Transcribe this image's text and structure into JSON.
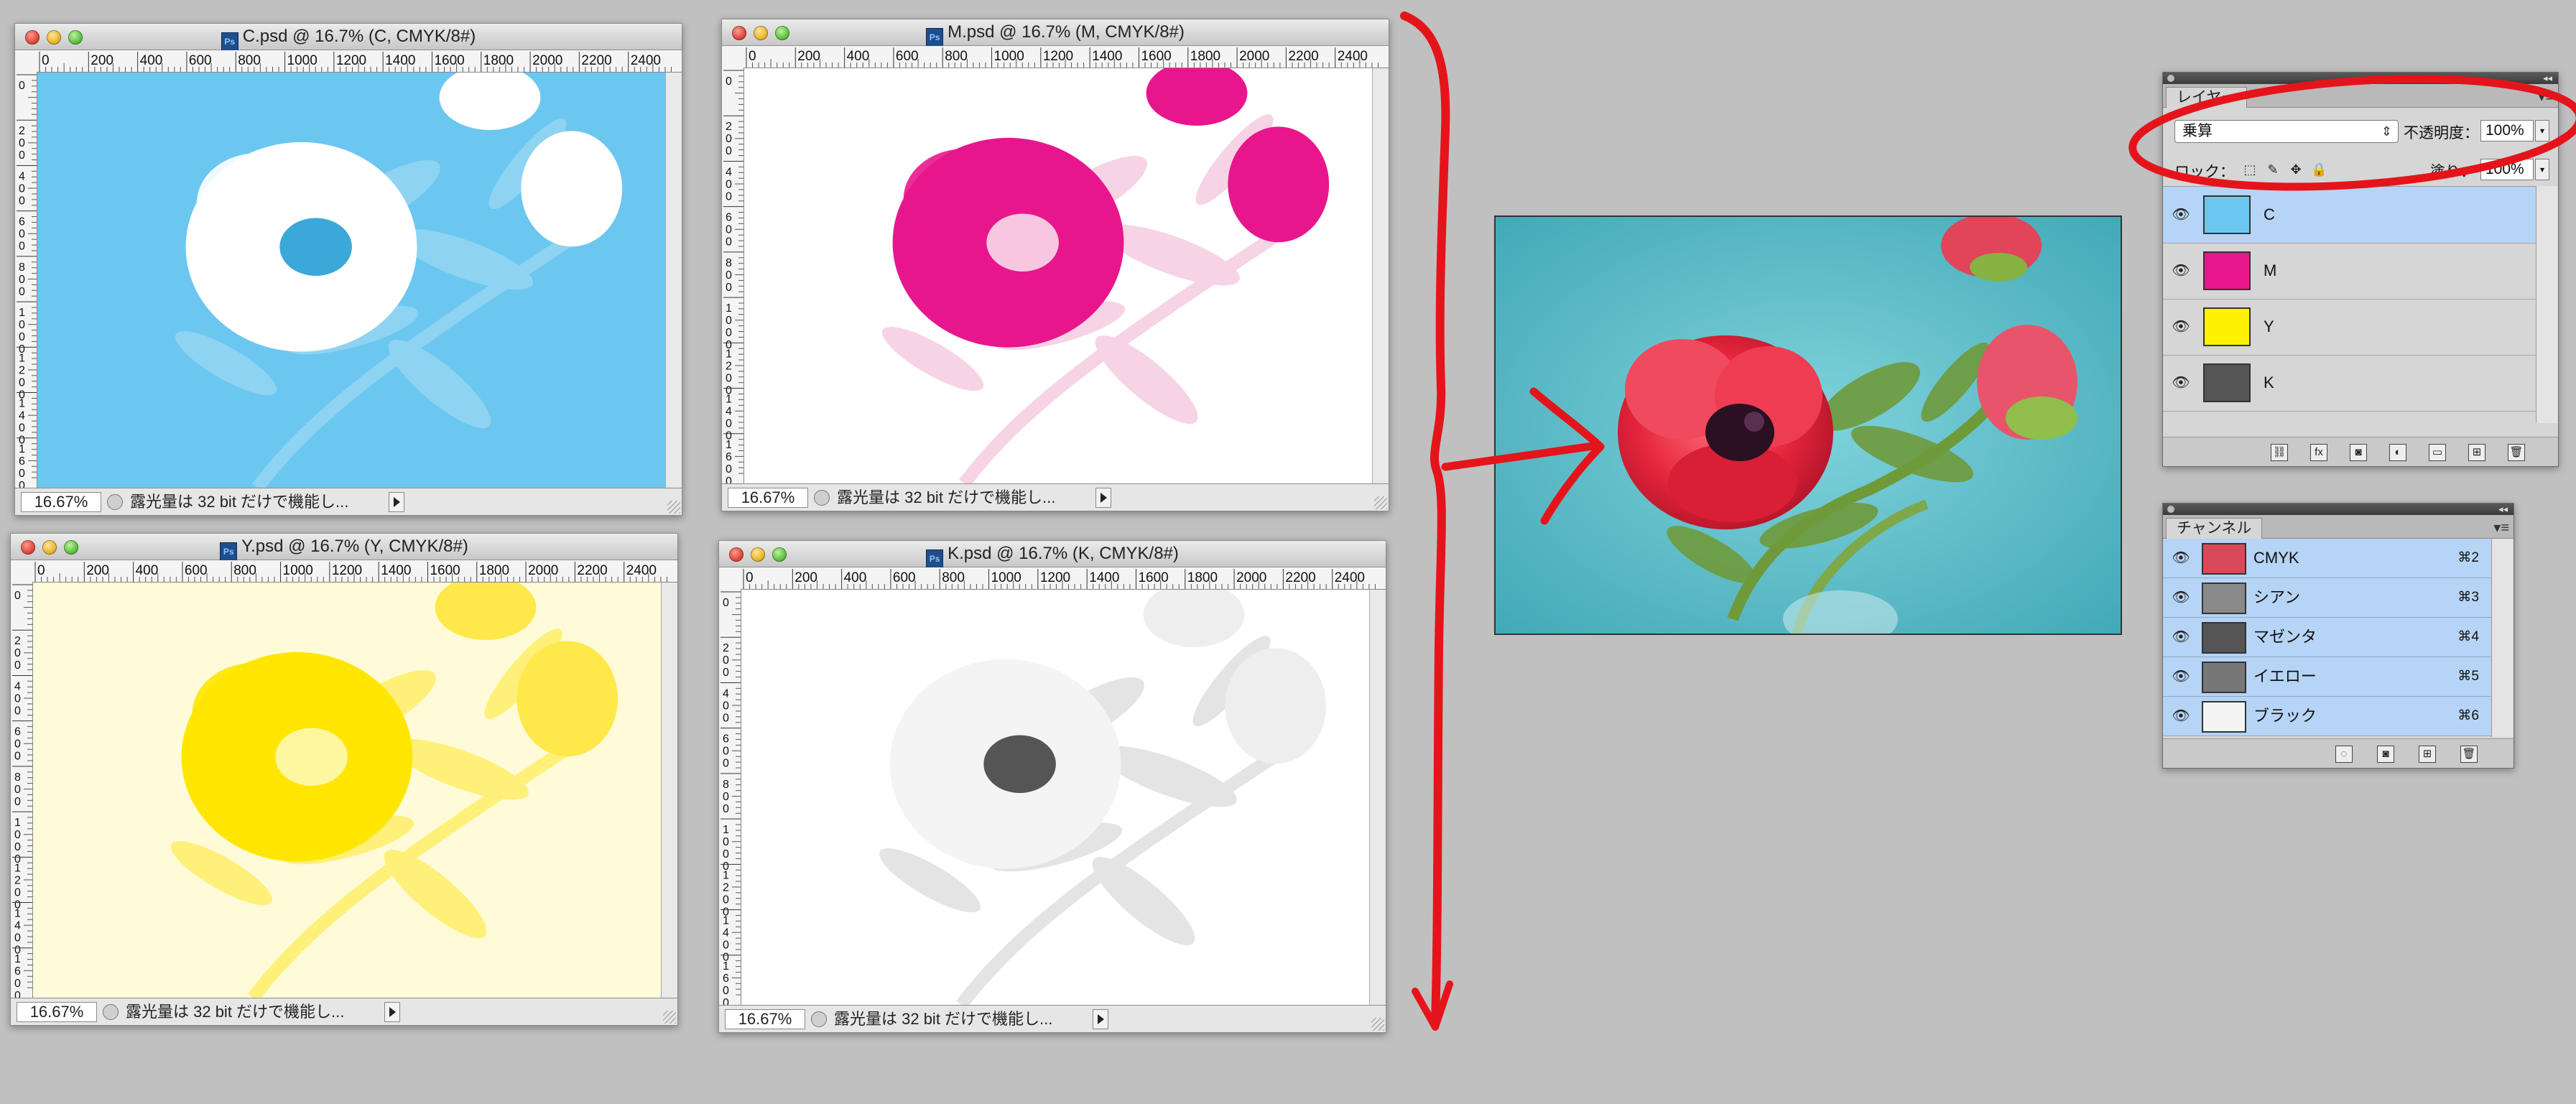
{
  "documents": [
    {
      "title": "C.psd @ 16.7% (C, CMYK/8#)",
      "zoom": "16.67%",
      "status": "露光量は 32 bit だけで機能し...",
      "tint": "#6cc7f0",
      "inkmode": "cyan"
    },
    {
      "title": "M.psd @ 16.7% (M, CMYK/8#)",
      "zoom": "16.67%",
      "status": "露光量は 32 bit だけで機能し...",
      "tint": "#e8168c",
      "inkmode": "magenta"
    },
    {
      "title": "Y.psd @ 16.7% (Y, CMYK/8#)",
      "zoom": "16.67%",
      "status": "露光量は 32 bit だけで機能し...",
      "tint": "#fff200",
      "inkmode": "yellow"
    },
    {
      "title": "K.psd @ 16.7% (K, CMYK/8#)",
      "zoom": "16.67%",
      "status": "露光量は 32 bit だけで機能し...",
      "tint": "#333333",
      "inkmode": "black"
    }
  ],
  "ruler": {
    "top_ticks": [
      "0",
      "200",
      "400",
      "600",
      "800",
      "1000",
      "1200",
      "1400",
      "1600",
      "1800",
      "2000",
      "2200",
      "2400"
    ],
    "left_ticks": [
      "0",
      "200",
      "400",
      "600",
      "800",
      "1000",
      "1200",
      "1400",
      "1600"
    ]
  },
  "layers_panel": {
    "tab": "レイヤー",
    "blend_mode": "乗算",
    "opacity_label": "不透明度：",
    "opacity": "100%",
    "lock_label": "ロック：",
    "fill_label": "塗り：",
    "fill": "100%",
    "layers": [
      {
        "name": "C",
        "selected": true,
        "thumb": "#6cc7f0"
      },
      {
        "name": "M",
        "selected": false,
        "thumb": "#e8168c"
      },
      {
        "name": "Y",
        "selected": false,
        "thumb": "#fff200"
      },
      {
        "name": "K",
        "selected": false,
        "thumb": "#555555"
      }
    ],
    "footer_icons": [
      "link-icon",
      "fx-icon",
      "mask-icon",
      "adjustment-icon",
      "group-icon",
      "new-layer-icon",
      "trash-icon"
    ]
  },
  "channels_panel": {
    "tab": "チャンネル",
    "channels": [
      {
        "name": "CMYK",
        "shortcut": "⌘2"
      },
      {
        "name": "シアン",
        "shortcut": "⌘3"
      },
      {
        "name": "マゼンタ",
        "shortcut": "⌘4"
      },
      {
        "name": "イエロー",
        "shortcut": "⌘5"
      },
      {
        "name": "ブラック",
        "shortcut": "⌘6"
      }
    ],
    "footer_icons": [
      "load-selection-icon",
      "save-selection-icon",
      "new-channel-icon",
      "trash-icon"
    ]
  },
  "colors": {
    "annotation_red": "#e5141b",
    "selection_blue": "#b6d4f5",
    "photo_background": "#5ec0cc",
    "flower_red": "#e5253a",
    "leaf_green": "#6f9a3a"
  }
}
